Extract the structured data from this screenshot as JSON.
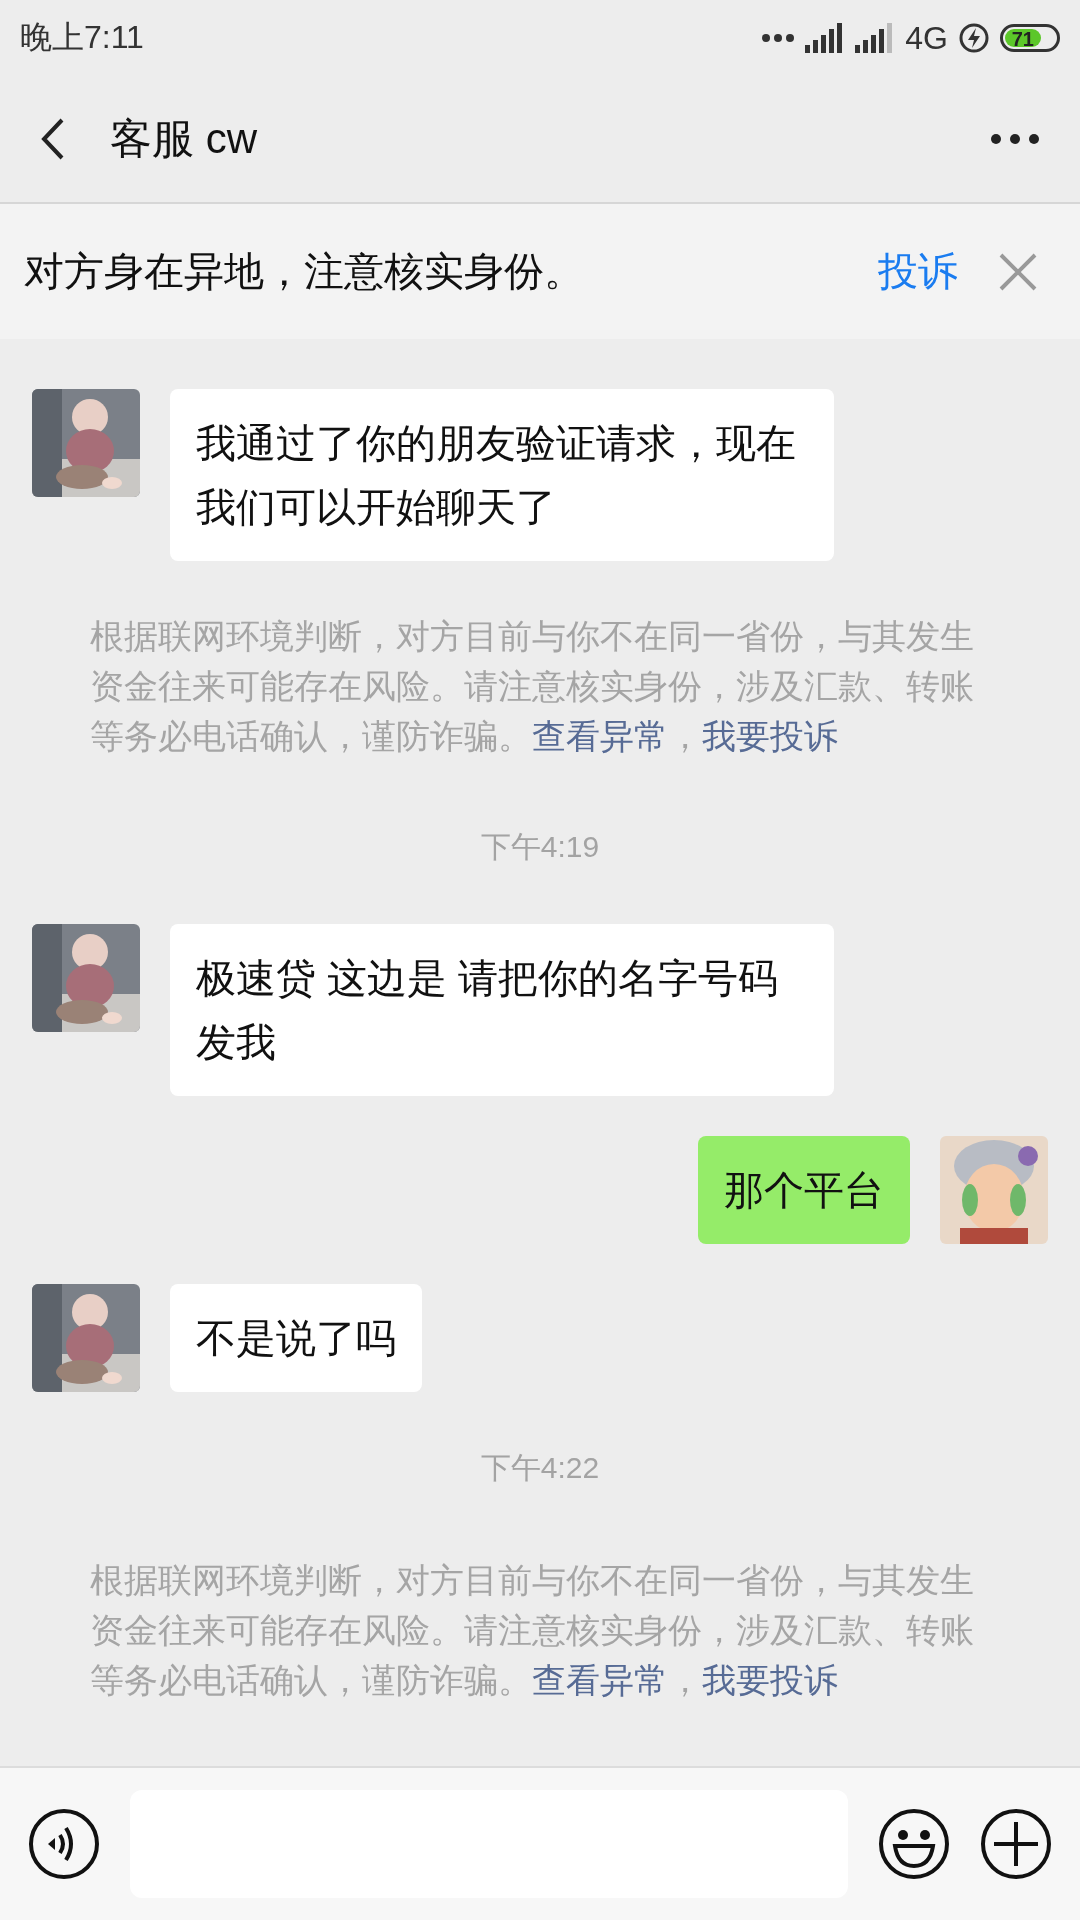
{
  "status_bar": {
    "time": "晚上7:11",
    "network": "4G",
    "battery": "71"
  },
  "nav": {
    "title": "客服 cw"
  },
  "banner": {
    "text": "对方身在异地，注意核实身份。",
    "action": "投诉"
  },
  "messages": [
    {
      "kind": "text",
      "outgoing": false,
      "text": "我通过了你的朋友验证请求，现在我们可以开始聊天了"
    },
    {
      "kind": "notice",
      "text": "根据联网环境判断，对方目前与你不在同一省份，与其发生资金往来可能存在风险。请注意核实身份，涉及汇款、转账等务必电话确认，谨防诈骗。",
      "links": [
        "查看异常",
        "我要投诉"
      ],
      "separator": "，"
    },
    {
      "kind": "time",
      "text": "下午4:19"
    },
    {
      "kind": "text",
      "outgoing": false,
      "text": "极速贷 这边是 请把你的名字号码发我"
    },
    {
      "kind": "text",
      "outgoing": true,
      "text": "那个平台"
    },
    {
      "kind": "text",
      "outgoing": false,
      "text": "不是说了吗"
    },
    {
      "kind": "time",
      "text": "下午4:22"
    },
    {
      "kind": "notice",
      "text": "根据联网环境判断，对方目前与你不在同一省份，与其发生资金往来可能存在风险。请注意核实身份，涉及汇款、转账等务必电话确认，谨防诈骗。",
      "links": [
        "查看异常",
        "我要投诉"
      ],
      "separator": "，"
    }
  ]
}
